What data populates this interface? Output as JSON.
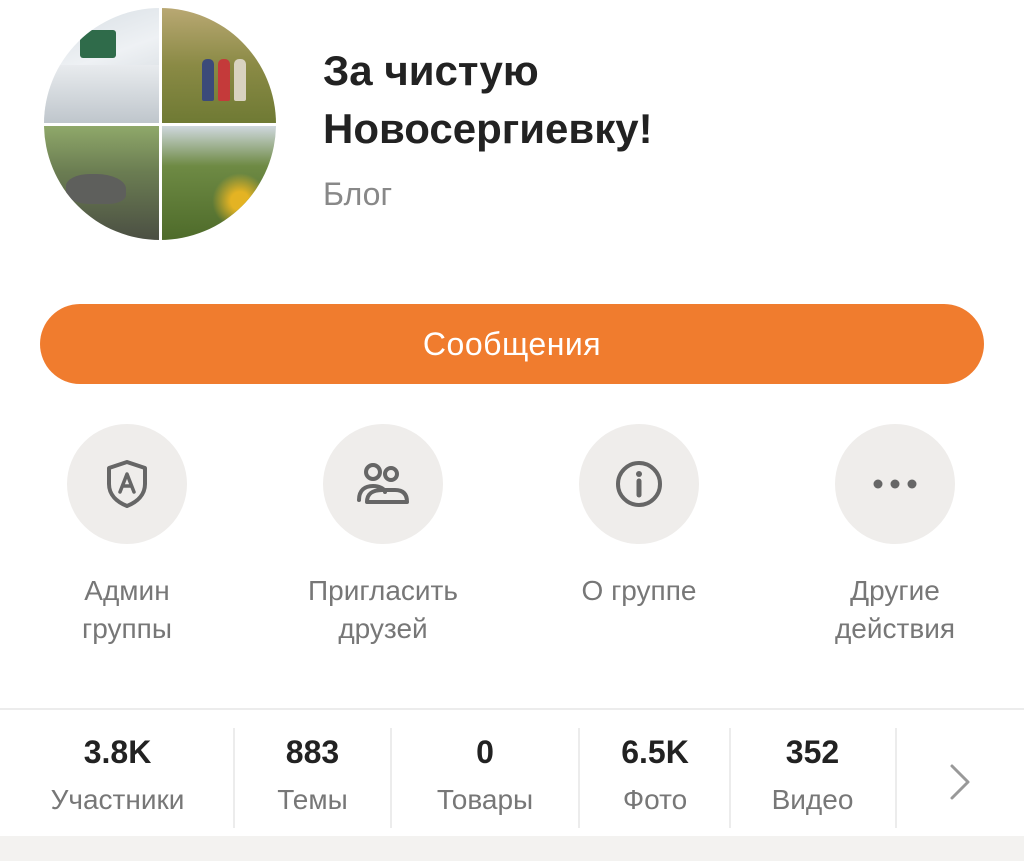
{
  "group": {
    "title": "За чистую\nНовосергиевку!",
    "type": "Блог"
  },
  "primary_action": {
    "label": "Сообщения"
  },
  "actions": [
    {
      "label": "Админ\nгруппы",
      "icon": "shield-a-icon"
    },
    {
      "label": "Пригласить\nдрузей",
      "icon": "people-icon"
    },
    {
      "label": "О группе",
      "icon": "info-icon"
    },
    {
      "label": "Другие\nдействия",
      "icon": "more-dots-icon"
    }
  ],
  "stats": [
    {
      "value": "3.8K",
      "label": "Участники"
    },
    {
      "value": "883",
      "label": "Темы"
    },
    {
      "value": "0",
      "label": "Товары"
    },
    {
      "value": "6.5K",
      "label": "Фото"
    },
    {
      "value": "352",
      "label": "Видео"
    }
  ],
  "colors": {
    "accent": "#f07c2e",
    "icon_bg": "#efedeb",
    "icon_stroke": "#666666"
  }
}
